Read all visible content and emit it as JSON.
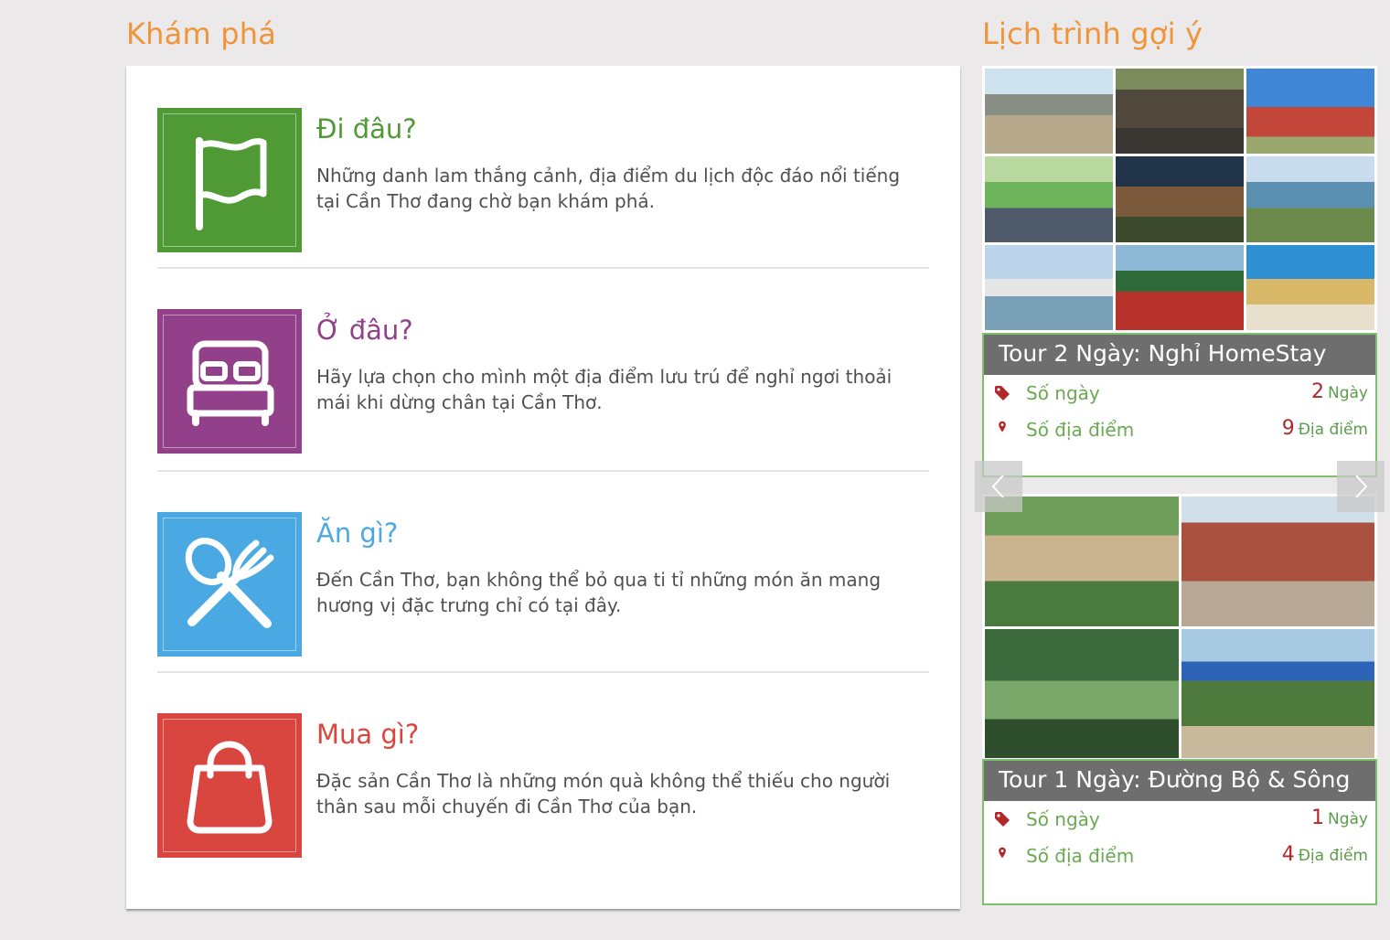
{
  "explore": {
    "title": "Khám phá",
    "items": [
      {
        "title": "Đi đâu?",
        "desc": "Những danh lam thắng cảnh, địa điểm du lịch độc đáo nổi tiếng tại Cần Thơ đang chờ bạn khám phá.",
        "color": "#4f9a34",
        "icon": "flag-icon"
      },
      {
        "title": "Ở đâu?",
        "desc": "Hãy lựa chọn cho mình một địa điểm lưu trú để nghỉ ngơi thoải mái khi dừng chân tại Cần Thơ.",
        "color": "#93408a",
        "icon": "bed-icon"
      },
      {
        "title": "Ăn gì?",
        "desc": "Đến Cần Thơ, bạn không thể bỏ qua ti tỉ những món ăn mang hương vị đặc trưng chỉ có tại đây.",
        "color": "#4aa8e2",
        "icon": "fork-spoon-icon"
      },
      {
        "title": "Mua gì?",
        "desc": "Đặc sản Cần Thơ là những món quà không thể thiếu cho người thân sau mỗi chuyến đi Cần Thơ của bạn.",
        "color": "#d9463f",
        "icon": "shopping-bag-icon"
      }
    ]
  },
  "itinerary": {
    "title": "Lịch trình gợi ý",
    "tours": [
      {
        "name": "Tour 2 Ngày: Nghỉ HomeStay",
        "days_label": "Số ngày",
        "days": "2",
        "days_unit": "Ngày",
        "places_label": "Số địa điểm",
        "places": "9",
        "places_unit": "Địa điểm"
      },
      {
        "name": "Tour 1 Ngày: Đường Bộ & Sông",
        "days_label": "Số ngày",
        "days": "1",
        "days_unit": "Ngày",
        "places_label": "Số địa điểm",
        "places": "4",
        "places_unit": "Địa điểm"
      }
    ]
  }
}
